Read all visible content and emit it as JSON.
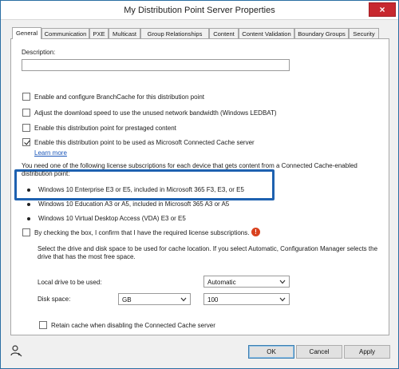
{
  "window": {
    "title": "My Distribution Point Server Properties",
    "close_glyph": "×"
  },
  "tabs": [
    {
      "label": "General",
      "active": true
    },
    {
      "label": "Communication",
      "active": false
    },
    {
      "label": "PXE",
      "active": false
    },
    {
      "label": "Multicast",
      "active": false
    },
    {
      "label": "Group Relationships",
      "active": false
    },
    {
      "label": "Content",
      "active": false
    },
    {
      "label": "Content Validation",
      "active": false
    },
    {
      "label": "Boundary Groups",
      "active": false
    },
    {
      "label": "Security",
      "active": false
    }
  ],
  "general": {
    "description_label": "Description:",
    "description_value": "",
    "options": [
      {
        "label": "Enable and configure BranchCache for this distribution point",
        "checked": false
      },
      {
        "label": "Adjust the download speed to use the unused network bandwidth (Windows LEDBAT)",
        "checked": false
      },
      {
        "label": "Enable this distribution point for prestaged content",
        "checked": false
      },
      {
        "label": "Enable this distribution point to be used as Microsoft Connected Cache server",
        "checked": true
      }
    ],
    "learn_more": "Learn more",
    "license_intro": "You need one of the following license subscriptions for each device that gets content from a Connected Cache-enabled distribution point:",
    "licenses": [
      "Windows 10 Enterprise E3 or E5, included in Microsoft 365 F3, E3, or E5",
      "Windows 10 Education A3 or A5, included in Microsoft 365 A3 or A5",
      "Windows 10 Virtual Desktop Access (VDA) E3 or E5"
    ],
    "confirm_label": "By checking the box, I confirm that I have the required license subscriptions.",
    "confirm_checked": false,
    "warning_glyph": "!",
    "drive_description": "Select the drive and disk space to be used for cache location. If you select Automatic, Configuration Manager selects the drive that has the most free space.",
    "local_drive_label": "Local drive to be used:",
    "local_drive_value": "Automatic",
    "disk_space_label": "Disk space:",
    "disk_space_unit": "GB",
    "disk_space_value": "100",
    "retain_label": "Retain cache when disabling the Connected Cache server",
    "retain_checked": false
  },
  "buttons": {
    "ok": "OK",
    "cancel": "Cancel",
    "apply": "Apply"
  },
  "colors": {
    "highlight": "#1e61b0",
    "close_red": "#c7282f",
    "link": "#1a55b8",
    "warning": "#d9411e"
  }
}
